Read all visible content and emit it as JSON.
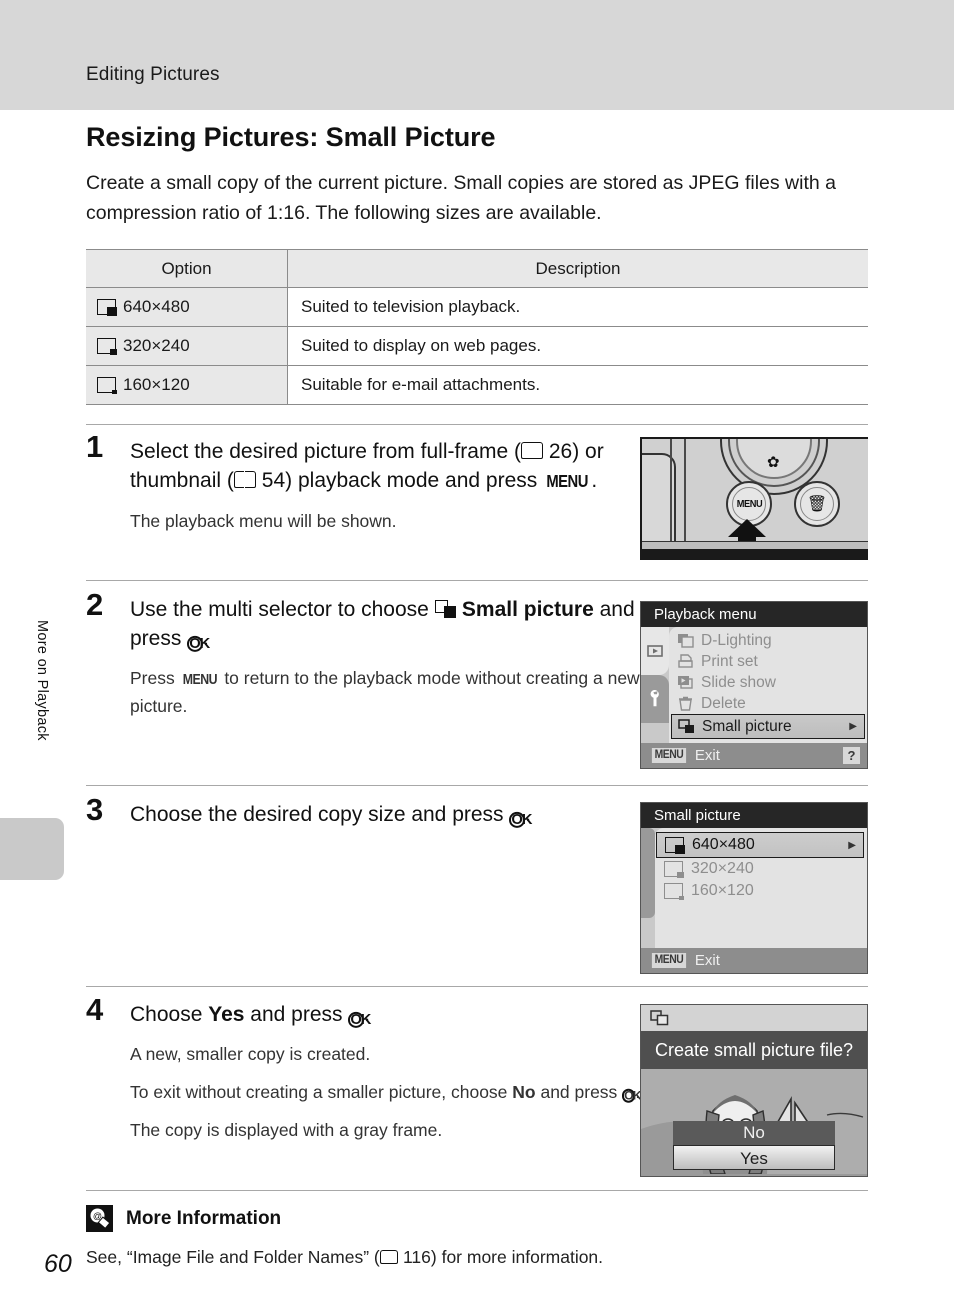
{
  "header": {
    "chapter": "Editing Pictures"
  },
  "side_tab": {
    "label": "More on Playback"
  },
  "folio": "60",
  "section": {
    "title": "Resizing Pictures: Small Picture",
    "intro": "Create a small copy of the current picture. Small copies are stored as JPEG files with a compression ratio of 1:16. The following sizes are available."
  },
  "option_table": {
    "headers": [
      "Option",
      "Description"
    ],
    "rows": [
      {
        "icon": "small-picture-640-icon",
        "option": "640×480",
        "description": "Suited to television playback."
      },
      {
        "icon": "small-picture-320-icon",
        "option": "320×240",
        "description": "Suited to display on web pages."
      },
      {
        "icon": "small-picture-160-icon",
        "option": "160×120",
        "description": "Suitable for e-mail attachments."
      }
    ]
  },
  "steps": [
    {
      "number": "1",
      "lead_1": "Select the desired picture from full-frame (",
      "page_ref_1": "26",
      "lead_2": ") or thumbnail (",
      "page_ref_2": "54",
      "lead_3": ") playback mode and press ",
      "menu_key": "MENU",
      "lead_4": ".",
      "sub": "The playback menu will be shown."
    },
    {
      "number": "2",
      "lead_1": "Use the multi selector to choose ",
      "bold_1": "Small picture",
      "lead_2": " and press ",
      "ok_key": "OK",
      "lead_3": ".",
      "sub_1": "Press ",
      "sub_menu_key": "MENU",
      "sub_2": " to return to the playback mode without creating a new picture."
    },
    {
      "number": "3",
      "lead_1": "Choose the desired copy size and press ",
      "ok_key": "OK",
      "lead_2": "."
    },
    {
      "number": "4",
      "lead_1": "Choose ",
      "bold_1": "Yes",
      "lead_2": " and press ",
      "ok_key": "OK",
      "lead_3": ".",
      "sub_a": "A new, smaller copy is created.",
      "sub_b_1": "To exit without creating a smaller picture, choose ",
      "sub_b_bold": "No",
      "sub_b_2": " and press ",
      "sub_b_ok": "OK",
      "sub_b_3": ".",
      "sub_c": "The copy is displayed with a gray frame."
    }
  ],
  "camera_figure": {
    "menu_button_label": "MENU",
    "delete_button_icon": "trash-icon",
    "macro_icon": "flower-macro-icon",
    "arrow_icon": "up-arrow-callout-icon"
  },
  "playback_menu_screen": {
    "title": "Playback menu",
    "tabs": [
      {
        "name": "playback-tab",
        "icon": "play-triangle-icon",
        "active": true
      },
      {
        "name": "setup-tab",
        "icon": "wrench-icon",
        "active": false
      }
    ],
    "items": [
      {
        "icon": "d-lighting-icon",
        "label": "D-Lighting",
        "selected": false
      },
      {
        "icon": "print-set-icon",
        "label": "Print set",
        "selected": false
      },
      {
        "icon": "slide-show-icon",
        "label": "Slide show",
        "selected": false
      },
      {
        "icon": "delete-trash-icon",
        "label": "Delete",
        "selected": false
      },
      {
        "icon": "small-picture-icon",
        "label": "Small picture",
        "selected": true
      }
    ],
    "footer": {
      "key": "MENU",
      "label": "Exit",
      "help": "?"
    }
  },
  "small_picture_screen": {
    "title": "Small picture",
    "items": [
      {
        "icon": "small-picture-640-icon",
        "label": "640×480",
        "selected": true
      },
      {
        "icon": "small-picture-320-icon",
        "label": "320×240",
        "selected": false
      },
      {
        "icon": "small-picture-160-icon",
        "label": "160×120",
        "selected": false
      }
    ],
    "footer": {
      "key": "MENU",
      "label": "Exit"
    }
  },
  "confirm_screen": {
    "icon": "small-picture-icon",
    "question": "Create small picture file?",
    "buttons": [
      {
        "label": "No",
        "selected": false
      },
      {
        "label": "Yes",
        "selected": true
      }
    ]
  },
  "more_information": {
    "icon": "tip-bulb-icon",
    "title": "More Information",
    "text_1": "See, “Image File and Folder Names” (",
    "page_ref": "116",
    "text_2": ") for more information."
  }
}
